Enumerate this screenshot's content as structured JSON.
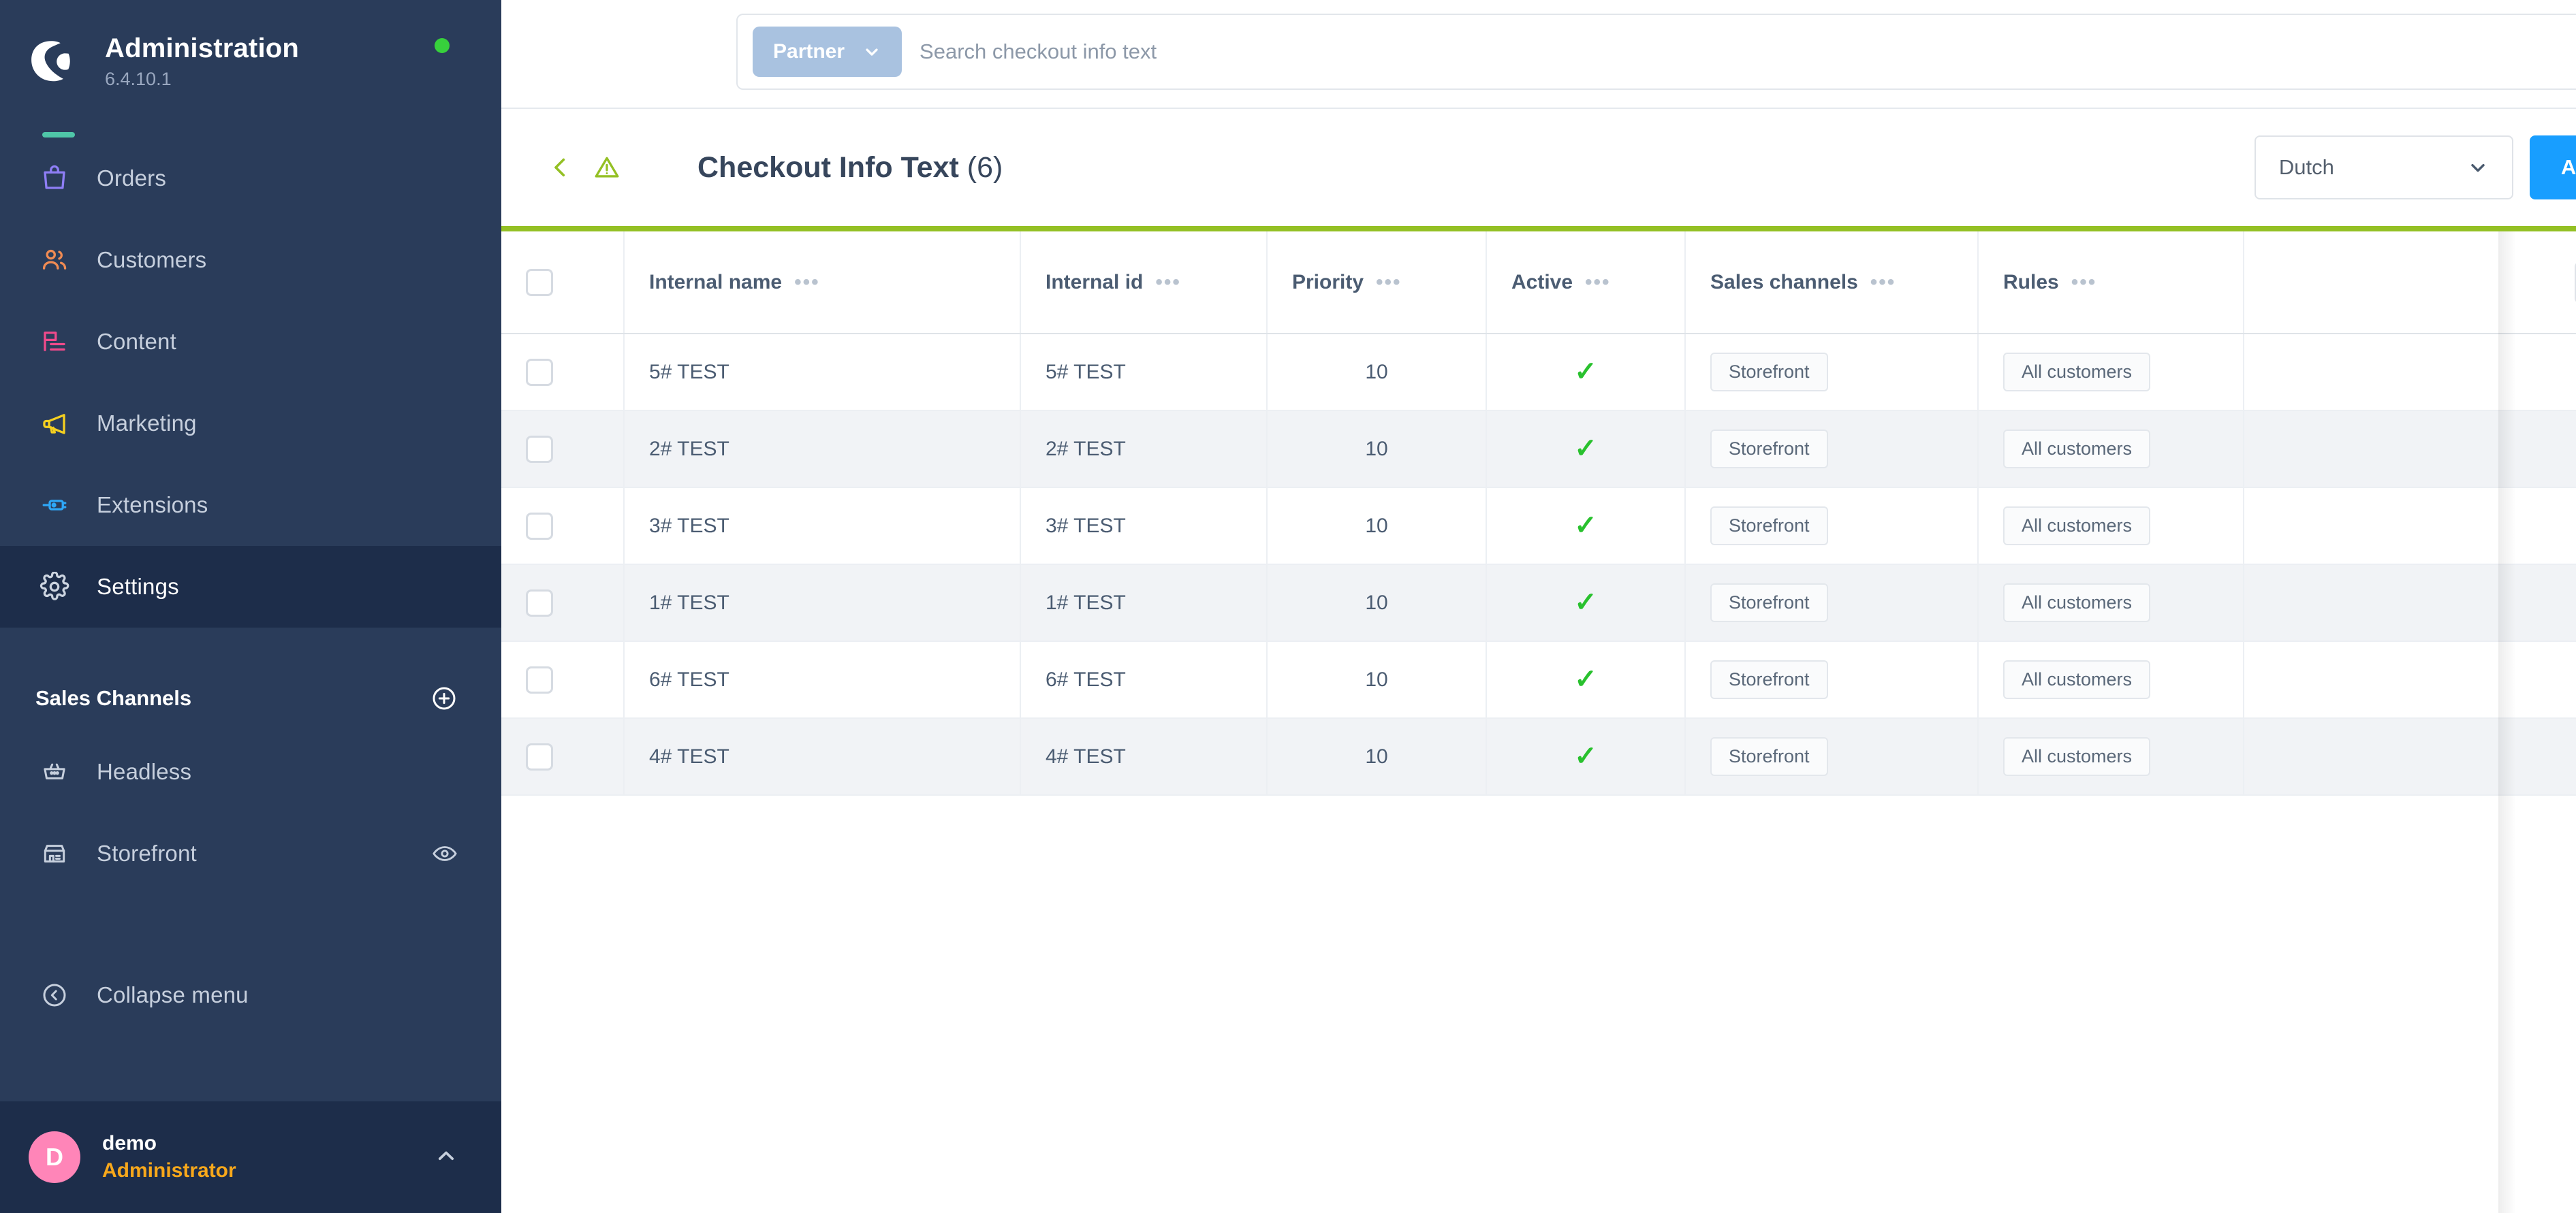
{
  "app": {
    "title": "Administration",
    "version": "6.4.10.1",
    "logo_icon": "shopware-logo-icon",
    "status_dot_color": "#37d13c"
  },
  "sidebar": {
    "nav_items": [
      {
        "label": "Orders",
        "icon": "bag-icon",
        "color": "#8e7ef5",
        "active": false
      },
      {
        "label": "Customers",
        "icon": "users-icon",
        "color": "#f08b53",
        "active": false
      },
      {
        "label": "Content",
        "icon": "content-icon",
        "color": "#ef4a8b",
        "active": false
      },
      {
        "label": "Marketing",
        "icon": "megaphone-icon",
        "color": "#f5d020",
        "active": false
      },
      {
        "label": "Extensions",
        "icon": "plug-icon",
        "color": "#2ea7f7",
        "active": false
      },
      {
        "label": "Settings",
        "icon": "gear-icon",
        "color": "#c6cfdd",
        "active": true
      }
    ],
    "sales_channels_section": {
      "title": "Sales Channels",
      "add_icon": "plus-circle-icon",
      "channels": [
        {
          "label": "Headless",
          "icon": "basket-icon"
        },
        {
          "label": "Storefront",
          "icon": "store-icon",
          "trailing_icon": "eye-icon"
        }
      ]
    },
    "collapse": {
      "label": "Collapse menu",
      "icon": "chevron-left-circle-icon"
    },
    "user": {
      "avatar_initial": "D",
      "avatar_color": "#ff85b8",
      "name": "demo",
      "role": "Administrator",
      "caret_icon": "chevron-up-icon"
    }
  },
  "topbar": {
    "search_scope": "Partner",
    "search_scope_caret_icon": "chevron-down-icon",
    "search_placeholder": "Search checkout info text",
    "search_value": "",
    "search_icon": "search-icon",
    "notification_icon": "bell-icon"
  },
  "page_header": {
    "back_icon": "chevron-left-icon",
    "warning_icon": "warning-triangle-icon",
    "title": "Checkout Info Text",
    "count": "(6)",
    "language_value": "Dutch",
    "language_caret_icon": "chevron-down-icon",
    "add_button": "Add checkout info text"
  },
  "grid": {
    "top_accent_color": "#94c024",
    "select_all_checkbox": false,
    "column_settings_icon": "column-settings-icon",
    "refresh_icon": "refresh-icon",
    "context_dots": "•••",
    "header_dots": "•••",
    "columns": [
      {
        "key": "internal_name",
        "label": "Internal name"
      },
      {
        "key": "internal_id",
        "label": "Internal id"
      },
      {
        "key": "priority",
        "label": "Priority"
      },
      {
        "key": "active",
        "label": "Active"
      },
      {
        "key": "sales_channels",
        "label": "Sales channels"
      },
      {
        "key": "rules",
        "label": "Rules"
      }
    ],
    "rows": [
      {
        "internal_name": "5# TEST",
        "internal_id": "5# TEST",
        "priority": "10",
        "active": true,
        "sales_channels": "Storefront",
        "rules": "All customers"
      },
      {
        "internal_name": "2# TEST",
        "internal_id": "2# TEST",
        "priority": "10",
        "active": true,
        "sales_channels": "Storefront",
        "rules": "All customers"
      },
      {
        "internal_name": "3# TEST",
        "internal_id": "3# TEST",
        "priority": "10",
        "active": true,
        "sales_channels": "Storefront",
        "rules": "All customers"
      },
      {
        "internal_name": "1# TEST",
        "internal_id": "1# TEST",
        "priority": "10",
        "active": true,
        "sales_channels": "Storefront",
        "rules": "All customers"
      },
      {
        "internal_name": "6# TEST",
        "internal_id": "6# TEST",
        "priority": "10",
        "active": true,
        "sales_channels": "Storefront",
        "rules": "All customers"
      },
      {
        "internal_name": "4# TEST",
        "internal_id": "4# TEST",
        "priority": "10",
        "active": true,
        "sales_channels": "Storefront",
        "rules": "All customers"
      }
    ],
    "active_tick": "✓"
  }
}
